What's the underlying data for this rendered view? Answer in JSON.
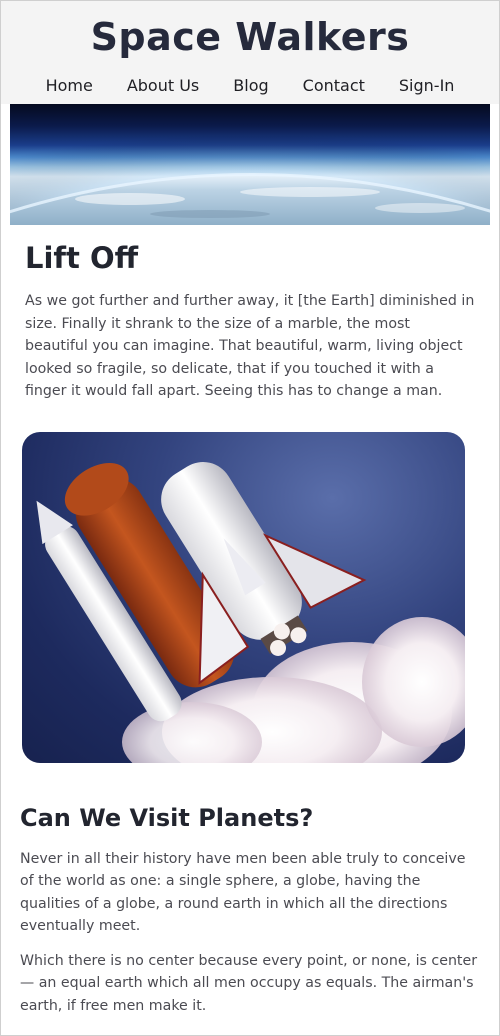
{
  "site": {
    "title": "Space Walkers"
  },
  "nav": {
    "items": [
      {
        "label": "Home"
      },
      {
        "label": "About Us"
      },
      {
        "label": "Blog"
      },
      {
        "label": "Contact"
      },
      {
        "label": "Sign-In"
      }
    ]
  },
  "hero": {
    "image_subject": "earth-horizon-from-space"
  },
  "article": {
    "lift_off": {
      "title": "Lift Off",
      "text": "As we got further and further away, it [the Earth] diminished in size. Finally it shrank to the size of a marble, the most beautiful you can imagine. That beautiful, warm, living object looked so fragile, so delicate, that if you touched it with a finger it would fall apart. Seeing this has to change a man."
    },
    "rocket_image": {
      "subject": "space-shuttle-launch"
    },
    "planets": {
      "title": "Can We Visit Planets?",
      "paragraphs": [
        "Never in all their history have men been able truly to conceive of the world as one: a single sphere, a globe, having the qualities of a globe, a round earth in which all the directions eventually meet.",
        "Which there is no center because every point, or none, is center — an equal earth which all men occupy as equals. The airman's earth, if free men make it."
      ]
    }
  },
  "colors": {
    "header_bg": "#f4f4f4",
    "title": "#262a3c",
    "body_text": "#4b4b52"
  }
}
